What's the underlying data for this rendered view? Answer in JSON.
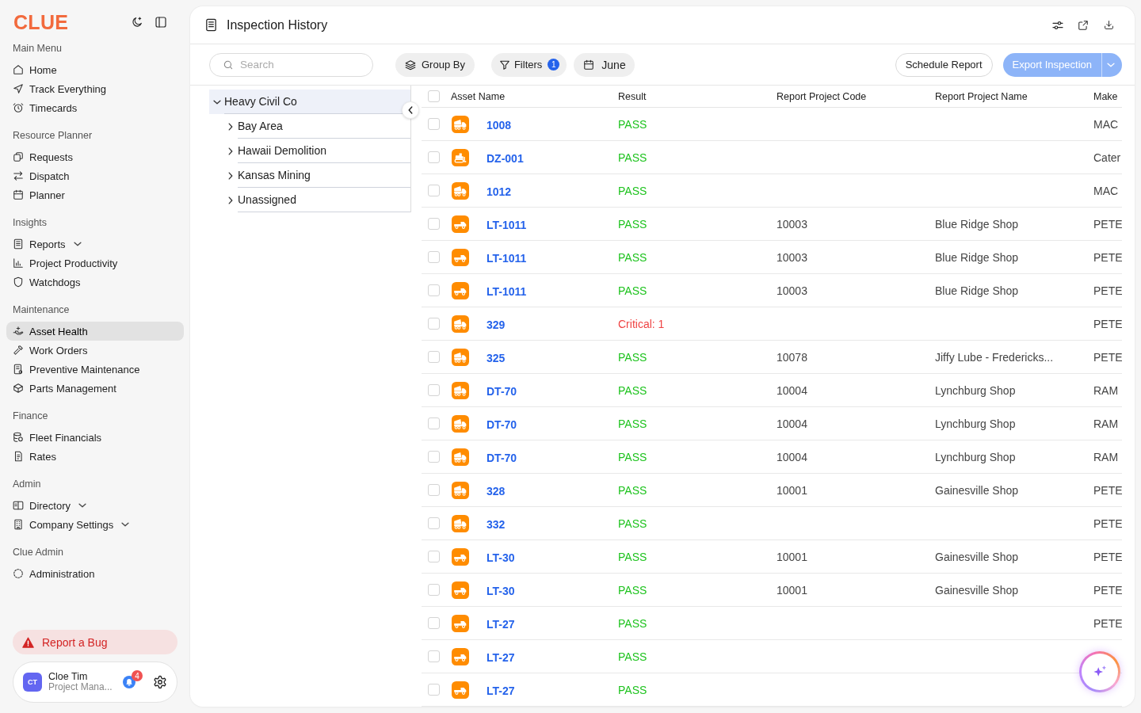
{
  "sidebar": {
    "logo": "CLUE",
    "sections": [
      {
        "heading": "Main Menu",
        "items": [
          {
            "label": "Home",
            "kind": "link",
            "selected": false
          },
          {
            "label": "Track Everything",
            "kind": "link",
            "selected": false
          },
          {
            "label": "Timecards",
            "kind": "link",
            "selected": false
          }
        ]
      },
      {
        "heading": "Resource Planner",
        "items": [
          {
            "label": "Requests",
            "kind": "link",
            "selected": false
          },
          {
            "label": "Dispatch",
            "kind": "link",
            "selected": false
          },
          {
            "label": "Planner",
            "kind": "link",
            "selected": false
          }
        ]
      },
      {
        "heading": "Insights",
        "items": [
          {
            "label": "Reports",
            "kind": "group",
            "selected": false
          },
          {
            "label": "Project Productivity",
            "kind": "link",
            "selected": false
          },
          {
            "label": "Watchdogs",
            "kind": "link",
            "selected": false
          }
        ]
      },
      {
        "heading": "Maintenance",
        "items": [
          {
            "label": "Asset Health",
            "kind": "link",
            "selected": true
          },
          {
            "label": "Work Orders",
            "kind": "link",
            "selected": false
          },
          {
            "label": "Preventive Maintenance",
            "kind": "link",
            "selected": false
          },
          {
            "label": "Parts Management",
            "kind": "link",
            "selected": false
          }
        ]
      },
      {
        "heading": "Finance",
        "items": [
          {
            "label": "Fleet Financials",
            "kind": "link",
            "selected": false
          },
          {
            "label": "Rates",
            "kind": "link",
            "selected": false
          }
        ]
      },
      {
        "heading": "Admin",
        "items": [
          {
            "label": "Directory",
            "kind": "group",
            "selected": false
          },
          {
            "label": "Company Settings",
            "kind": "group",
            "selected": false
          }
        ]
      },
      {
        "heading": "Clue Admin",
        "items": [
          {
            "label": "Administration",
            "kind": "link",
            "selected": false
          }
        ]
      }
    ],
    "report_bug": "Report a Bug",
    "user": {
      "initials": "CT",
      "name": "Cloe Tim",
      "role": "Project Mana...",
      "notifications": "4"
    }
  },
  "page": {
    "title": "Inspection History"
  },
  "toolbar": {
    "search": {
      "placeholder": "Search"
    },
    "group_by": "Group By",
    "filters": {
      "label": "Filters",
      "count": "1"
    },
    "date": "June",
    "schedule_report": "Schedule Report",
    "export": {
      "label": "Export Inspection",
      "disabled": true
    }
  },
  "tree": [
    {
      "label": "Heavy Civil Co",
      "expanded": true,
      "selected": true,
      "children": [
        {
          "label": "Bay Area",
          "expanded": false,
          "selected": false
        },
        {
          "label": "Hawaii Demolition",
          "expanded": false,
          "selected": false
        },
        {
          "label": "Kansas Mining",
          "expanded": false,
          "selected": false
        },
        {
          "label": "Unassigned",
          "expanded": false,
          "selected": false
        }
      ]
    }
  ],
  "table": {
    "columns": [
      "Asset Name",
      "Result",
      "Report Project Code",
      "Report Project Name",
      "Make"
    ],
    "all_checked": false,
    "rows": [
      {
        "checked": false,
        "kind": "dump_truck",
        "asset": "1008",
        "result": {
          "text": "PASS",
          "kind": "pass"
        },
        "make": "MAC"
      },
      {
        "checked": false,
        "kind": "dozer",
        "asset": "DZ-001",
        "result": {
          "text": "PASS",
          "kind": "pass"
        },
        "make": "Cater"
      },
      {
        "checked": false,
        "kind": "dump_truck",
        "asset": "1012",
        "result": {
          "text": "PASS",
          "kind": "pass"
        },
        "make": "MAC"
      },
      {
        "checked": false,
        "kind": "pickup",
        "asset": "LT-1011",
        "result": {
          "text": "PASS",
          "kind": "pass"
        },
        "code": "10003",
        "project": "Blue Ridge Shop",
        "make": "PETE"
      },
      {
        "checked": false,
        "kind": "pickup",
        "asset": "LT-1011",
        "result": {
          "text": "PASS",
          "kind": "pass"
        },
        "code": "10003",
        "project": "Blue Ridge Shop",
        "make": "PETE"
      },
      {
        "checked": false,
        "kind": "pickup",
        "asset": "LT-1011",
        "result": {
          "text": "PASS",
          "kind": "pass"
        },
        "code": "10003",
        "project": "Blue Ridge Shop",
        "make": "PETE"
      },
      {
        "checked": false,
        "kind": "dump_truck",
        "asset": "329",
        "result": {
          "text": "Critical: 1",
          "kind": "critical"
        },
        "make": "PETE"
      },
      {
        "checked": false,
        "kind": "dump_truck",
        "asset": "325",
        "result": {
          "text": "PASS",
          "kind": "pass"
        },
        "code": "10078",
        "project": "Jiffy Lube - Fredericks...",
        "make": "PETE"
      },
      {
        "checked": false,
        "kind": "dump_truck",
        "asset": "DT-70",
        "result": {
          "text": "PASS",
          "kind": "pass"
        },
        "code": "10004",
        "project": "Lynchburg Shop",
        "make": "RAM"
      },
      {
        "checked": false,
        "kind": "dump_truck",
        "asset": "DT-70",
        "result": {
          "text": "PASS",
          "kind": "pass"
        },
        "code": "10004",
        "project": "Lynchburg Shop",
        "make": "RAM"
      },
      {
        "checked": false,
        "kind": "dump_truck",
        "asset": "DT-70",
        "result": {
          "text": "PASS",
          "kind": "pass"
        },
        "code": "10004",
        "project": "Lynchburg Shop",
        "make": "RAM"
      },
      {
        "checked": false,
        "kind": "dump_truck",
        "asset": "328",
        "result": {
          "text": "PASS",
          "kind": "pass"
        },
        "code": "10001",
        "project": "Gainesville Shop",
        "make": "PETE"
      },
      {
        "checked": false,
        "kind": "dump_truck",
        "asset": "332",
        "result": {
          "text": "PASS",
          "kind": "pass"
        },
        "make": "PETE"
      },
      {
        "checked": false,
        "kind": "pickup",
        "asset": "LT-30",
        "result": {
          "text": "PASS",
          "kind": "pass"
        },
        "code": "10001",
        "project": "Gainesville Shop",
        "make": "PETE"
      },
      {
        "checked": false,
        "kind": "pickup",
        "asset": "LT-30",
        "result": {
          "text": "PASS",
          "kind": "pass"
        },
        "code": "10001",
        "project": "Gainesville Shop",
        "make": "PETE"
      },
      {
        "checked": false,
        "kind": "pickup",
        "asset": "LT-27",
        "result": {
          "text": "PASS",
          "kind": "pass"
        },
        "make": "PETE"
      },
      {
        "checked": false,
        "kind": "pickup",
        "asset": "LT-27",
        "result": {
          "text": "PASS",
          "kind": "pass"
        }
      },
      {
        "checked": false,
        "kind": "pickup",
        "asset": "LT-27",
        "result": {
          "text": "PASS",
          "kind": "pass"
        }
      }
    ]
  }
}
